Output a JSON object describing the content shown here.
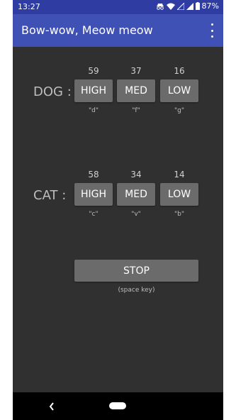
{
  "status_bar": {
    "time": "13:27",
    "battery": "87%",
    "icons": [
      "incognito-icon",
      "wifi-icon",
      "signal-icon",
      "signal-icon",
      "battery-icon"
    ]
  },
  "app_bar": {
    "title": "Bow-wow, Meow meow",
    "menu_icon": "more-vert-icon"
  },
  "dog": {
    "label": "DOG :",
    "counts": [
      "59",
      "37",
      "16"
    ],
    "buttons": [
      "HIGH",
      "MED",
      "LOW"
    ],
    "keys": [
      "\"d\"",
      "\"f\"",
      "\"g\""
    ]
  },
  "cat": {
    "label": "CAT :",
    "counts": [
      "58",
      "34",
      "14"
    ],
    "buttons": [
      "HIGH",
      "MED",
      "LOW"
    ],
    "keys": [
      "\"c\"",
      "\"v\"",
      "\"b\""
    ]
  },
  "stop": {
    "label": "STOP",
    "hint": "(space key)"
  },
  "nav_bar": {
    "back_icon": "back-chevron-icon",
    "home_icon": "home-pill-icon"
  },
  "colors": {
    "status_bar": "#2f3da3",
    "app_bar": "#3f51b5",
    "background": "#303030",
    "button": "#6b6b6b"
  }
}
